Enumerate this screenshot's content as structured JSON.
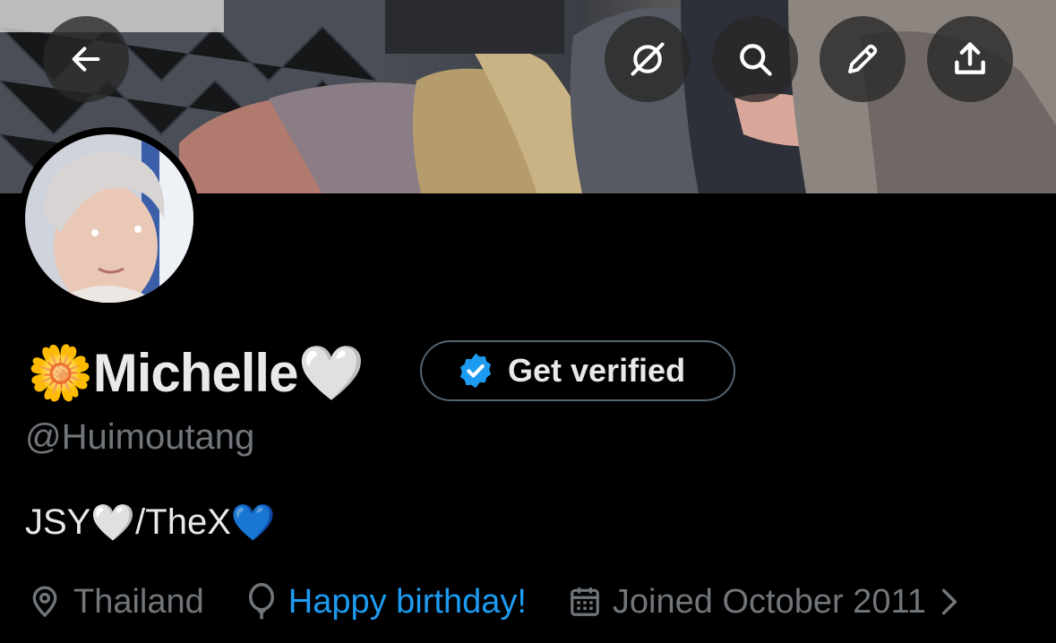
{
  "header": {
    "back_icon": "arrow-left-icon",
    "actions": [
      "grok-icon",
      "search-icon",
      "pencil-icon",
      "share-icon"
    ]
  },
  "profile": {
    "name_emoji_prefix": "🌼",
    "name": "Michelle",
    "name_emoji_suffix": "🤍",
    "handle": "@Huimoutang",
    "bio_1": "JSY",
    "bio_emoji_1": "🤍",
    "bio_2": "/TheX",
    "bio_emoji_2": "💙"
  },
  "verify": {
    "label": "Get verified",
    "badge_color": "#1d9bf0"
  },
  "meta": {
    "location": "Thailand",
    "birthday": "Happy birthday!",
    "joined": "Joined October 2011"
  },
  "colors": {
    "accent": "#1d9bf0",
    "muted": "#71767b",
    "text": "#e7e9ea"
  }
}
